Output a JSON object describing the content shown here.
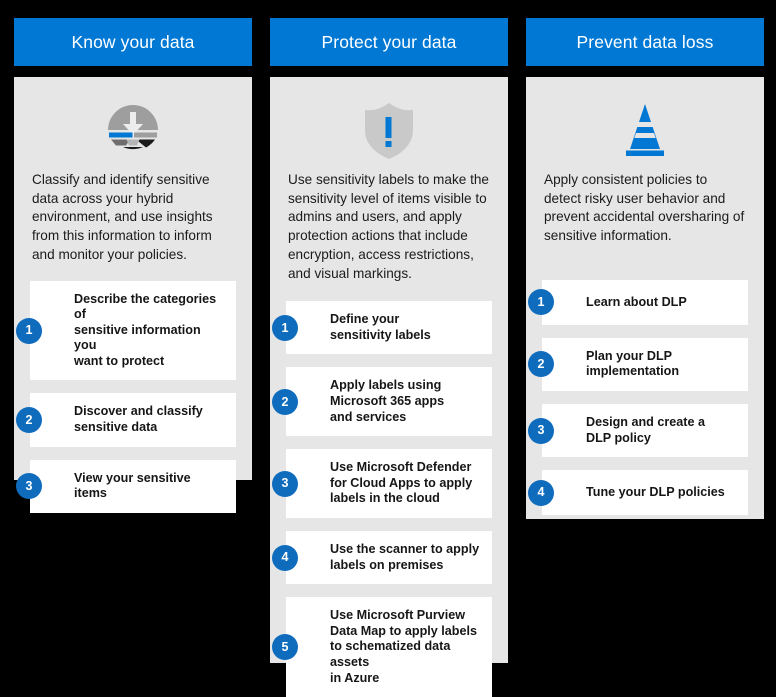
{
  "theme": {
    "background": "#000000",
    "header_blue": "#0078D4",
    "panel_gray": "#E6E6E6",
    "card_white": "#FFFFFF",
    "badge_blue": "#0F6CBD",
    "icon_gray": "#9E9E9E",
    "icon_blue": "#0078D4"
  },
  "columns": [
    {
      "header": "Know your data",
      "icon": "classify-data-icon",
      "intro": "Classify and identify sensitive data across your hybrid environment, and use insights from this information to inform and monitor your policies.",
      "steps": [
        {
          "number": "1",
          "label": "Describe the categories of\nsensitive information you\nwant to protect"
        },
        {
          "number": "2",
          "label": "Discover and classify\nsensitive data"
        },
        {
          "number": "3",
          "label": "View your sensitive items"
        }
      ]
    },
    {
      "header": "Protect your data",
      "icon": "shield-exclamation-icon",
      "intro": "Use sensitivity labels to make the sensitivity level of items visible to admins and users, and apply protection actions that include encryption, access restrictions, and visual markings.",
      "steps": [
        {
          "number": "1",
          "label": "Define your\nsensitivity labels"
        },
        {
          "number": "2",
          "label": "Apply labels using\nMicrosoft 365 apps\nand services"
        },
        {
          "number": "3",
          "label": "Use Microsoft Defender\nfor Cloud Apps to apply\nlabels in the cloud"
        },
        {
          "number": "4",
          "label": "Use the scanner to apply\nlabels on premises"
        },
        {
          "number": "5",
          "label": "Use Microsoft Purview\nData Map to apply labels\nto schematized data assets\nin Azure"
        }
      ]
    },
    {
      "header": "Prevent data loss",
      "icon": "traffic-cone-icon",
      "intro": "Apply consistent policies to detect risky user behavior and prevent accidental oversharing of sensitive information.",
      "steps": [
        {
          "number": "1",
          "label": "Learn about DLP"
        },
        {
          "number": "2",
          "label": "Plan your DLP\nimplementation"
        },
        {
          "number": "3",
          "label": "Design and create a\nDLP policy"
        },
        {
          "number": "4",
          "label": "Tune your DLP policies"
        }
      ]
    }
  ]
}
